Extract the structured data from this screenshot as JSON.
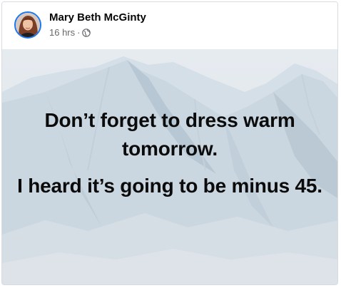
{
  "post": {
    "author": "Mary Beth McGinty",
    "time": "16 hrs",
    "separator": "·",
    "privacy_icon": "globe-icon",
    "message_line1": "Don’t forget to dress warm tomorrow.",
    "message_line2": "I heard it’s going to be minus 45."
  },
  "colors": {
    "avatar_ring": "#1877f2",
    "meta_text": "#65676b",
    "background_sky": "#dfe6ec"
  }
}
